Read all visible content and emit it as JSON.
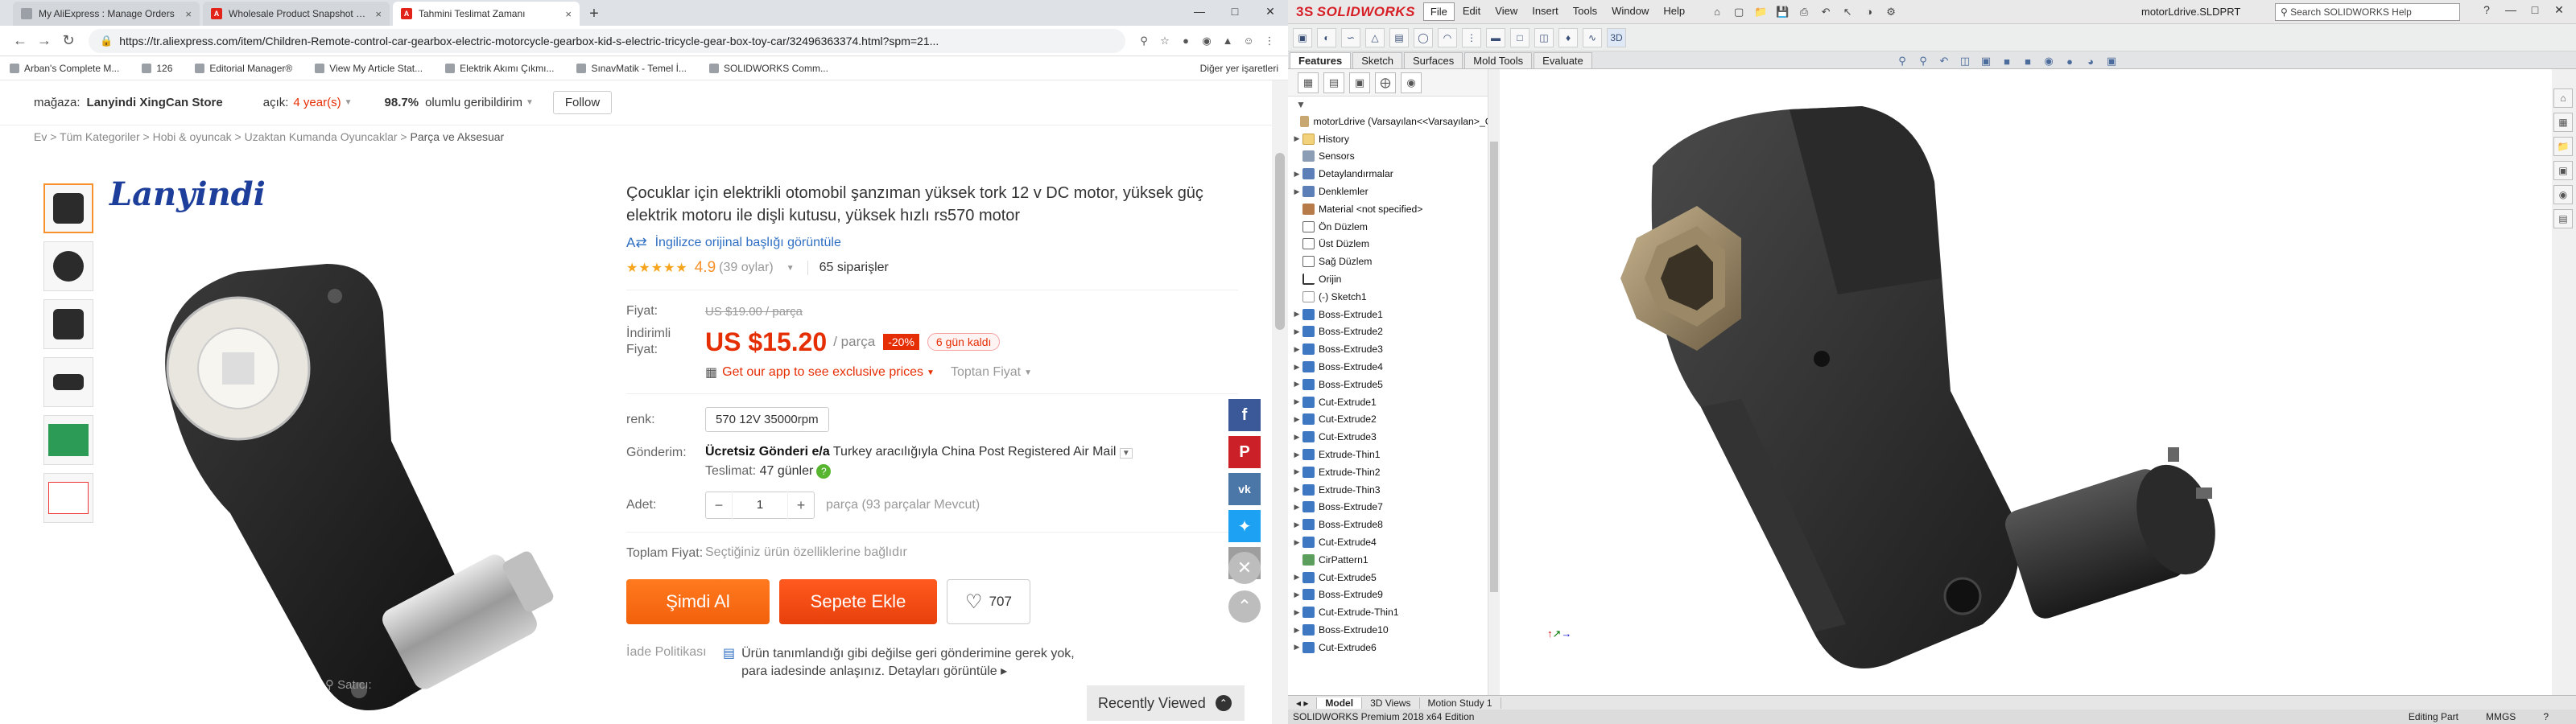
{
  "browser": {
    "tabs": [
      {
        "title": "My AliExpress : Manage Orders",
        "icon": "blank"
      },
      {
        "title": "Wholesale Product Snapshot Pr...",
        "icon": "ali"
      },
      {
        "title": "Tahmini Teslimat Zamanı",
        "icon": "ali"
      }
    ],
    "new_tab": "+",
    "url": "https://tr.aliexpress.com/item/Children-Remote-control-car-gearbox-electric-motorcycle-gearbox-kid-s-electric-tricycle-gear-box-toy-car/32496363374.html?spm=21...",
    "bookmarks": [
      "Arban's Complete M...",
      "126",
      "Editorial Manager®",
      "View My Article Stat...",
      "Elektrik Akımı Çıkmı...",
      "SınavMatik - Temel İ...",
      "SOLIDWORKS Comm..."
    ],
    "bookmarks_other": "Diğer yer işaretleri"
  },
  "store": {
    "label": "mağaza:",
    "name": "Lanyindi XingCan Store",
    "open_label": "açık:",
    "open_years": "4 year(s)",
    "positive_pct": "98.7%",
    "positive_label": "olumlu geribildirim",
    "follow": "Follow"
  },
  "breadcrumbs": [
    "Ev",
    "Tüm Kategoriler",
    "Hobi & oyuncak",
    "Uzaktan Kumanda Oyuncaklar",
    "Parça ve Aksesuar"
  ],
  "gallery": {
    "logo_text": "Lanyindi",
    "seller_label": "Satıcı:"
  },
  "product": {
    "title": "Çocuklar için elektrikli otomobil şanzıman yüksek tork 12 v DC motor, yüksek güç elektrik motoru ile dişli kutusu, yüksek hızlı rs570 motor",
    "translate": "İngilizce orijinal başlığı görüntüle",
    "rating": "4.9",
    "rating_count": "(39 oylar)",
    "orders": "65 siparişler",
    "price_label": "Fiyat:",
    "old_price": "US $19.00 / parça",
    "discount_label": "İndirimli Fiyat:",
    "new_price": "US $15.20",
    "per_unit": "/ parça",
    "discount": "-20%",
    "days_left": "6 gün kaldı",
    "app_offer": "Get our app to see exclusive prices",
    "bulk_price": "Toptan Fiyat",
    "color_label": "renk:",
    "color_option": "570 12V 35000rpm",
    "shipping_label": "Gönderim:",
    "shipping_free": "Ücretsiz Gönderi e/a",
    "shipping_info": "Turkey aracılığıyla China Post Registered Air Mail",
    "delivery_label": "Teslimat:",
    "delivery_days": "47 günler",
    "qty_label": "Adet:",
    "qty_minus": "−",
    "qty_value": "1",
    "qty_plus": "+",
    "qty_note": "parça (93 parçalar Mevcut)",
    "total_label": "Toplam Fiyat:",
    "total_note": "Seçtiğiniz ürün özelliklerine bağlıdır",
    "buy_now": "Şimdi Al",
    "add_cart": "Sepete Ekle",
    "wishlist_count": "707",
    "policy_label": "İade Politikası",
    "policy_text": "Ürün tanımlandığı gibi değilse geri gönderimine gerek yok, para iadesinde anlaşınız.",
    "policy_link": "Detayları görüntüle"
  },
  "recently_viewed": "Recently Viewed",
  "solidworks": {
    "logo": "SOLIDWORKS",
    "menu": [
      "File",
      "Edit",
      "View",
      "Insert",
      "Tools",
      "Window",
      "Help"
    ],
    "filename": "motorLdrive.SLDPRT",
    "search_placeholder": "Search SOLIDWORKS Help",
    "command_tabs": [
      "Features",
      "Sketch",
      "Surfaces",
      "Mold Tools",
      "Evaluate"
    ],
    "tree": [
      {
        "label": "motorLdrive  (Varsayılan<<Varsayılan>_Gö",
        "icon": "part",
        "exp": ""
      },
      {
        "label": "History",
        "icon": "fld",
        "exp": "▶"
      },
      {
        "label": "Sensors",
        "icon": "sen",
        "exp": ""
      },
      {
        "label": "Detaylandırmalar",
        "icon": "ann",
        "exp": "▶"
      },
      {
        "label": "Denklemler",
        "icon": "ann",
        "exp": "▶"
      },
      {
        "label": "Material <not specified>",
        "icon": "mat",
        "exp": ""
      },
      {
        "label": "Ön Düzlem",
        "icon": "pln",
        "exp": ""
      },
      {
        "label": "Üst Düzlem",
        "icon": "pln",
        "exp": ""
      },
      {
        "label": "Sağ Düzlem",
        "icon": "pln",
        "exp": ""
      },
      {
        "label": "Orijin",
        "icon": "org",
        "exp": ""
      },
      {
        "label": "(-) Sketch1",
        "icon": "skt",
        "exp": ""
      },
      {
        "label": "Boss-Extrude1",
        "icon": "feat",
        "exp": "▶"
      },
      {
        "label": "Boss-Extrude2",
        "icon": "feat",
        "exp": "▶"
      },
      {
        "label": "Boss-Extrude3",
        "icon": "feat",
        "exp": "▶"
      },
      {
        "label": "Boss-Extrude4",
        "icon": "feat",
        "exp": "▶"
      },
      {
        "label": "Boss-Extrude5",
        "icon": "feat",
        "exp": "▶"
      },
      {
        "label": "Cut-Extrude1",
        "icon": "feat",
        "exp": "▶"
      },
      {
        "label": "Cut-Extrude2",
        "icon": "feat",
        "exp": "▶"
      },
      {
        "label": "Cut-Extrude3",
        "icon": "feat",
        "exp": "▶"
      },
      {
        "label": "Extrude-Thin1",
        "icon": "feat",
        "exp": "▶"
      },
      {
        "label": "Extrude-Thin2",
        "icon": "feat",
        "exp": "▶"
      },
      {
        "label": "Extrude-Thin3",
        "icon": "feat",
        "exp": "▶"
      },
      {
        "label": "Boss-Extrude7",
        "icon": "feat",
        "exp": "▶"
      },
      {
        "label": "Boss-Extrude8",
        "icon": "feat",
        "exp": "▶"
      },
      {
        "label": "Cut-Extrude4",
        "icon": "feat",
        "exp": "▶"
      },
      {
        "label": "CirPattern1",
        "icon": "pat",
        "exp": ""
      },
      {
        "label": "Cut-Extrude5",
        "icon": "feat",
        "exp": "▶"
      },
      {
        "label": "Boss-Extrude9",
        "icon": "feat",
        "exp": "▶"
      },
      {
        "label": "Cut-Extrude-Thin1",
        "icon": "feat",
        "exp": "▶"
      },
      {
        "label": "Boss-Extrude10",
        "icon": "feat",
        "exp": "▶"
      },
      {
        "label": "Cut-Extrude6",
        "icon": "feat",
        "exp": "▶"
      }
    ],
    "bottom_tabs": [
      "Model",
      "3D Views",
      "Motion Study 1"
    ],
    "status_left": "SOLIDWORKS Premium 2018 x64 Edition",
    "status_mode": "Editing Part",
    "status_units": "MMGS"
  }
}
